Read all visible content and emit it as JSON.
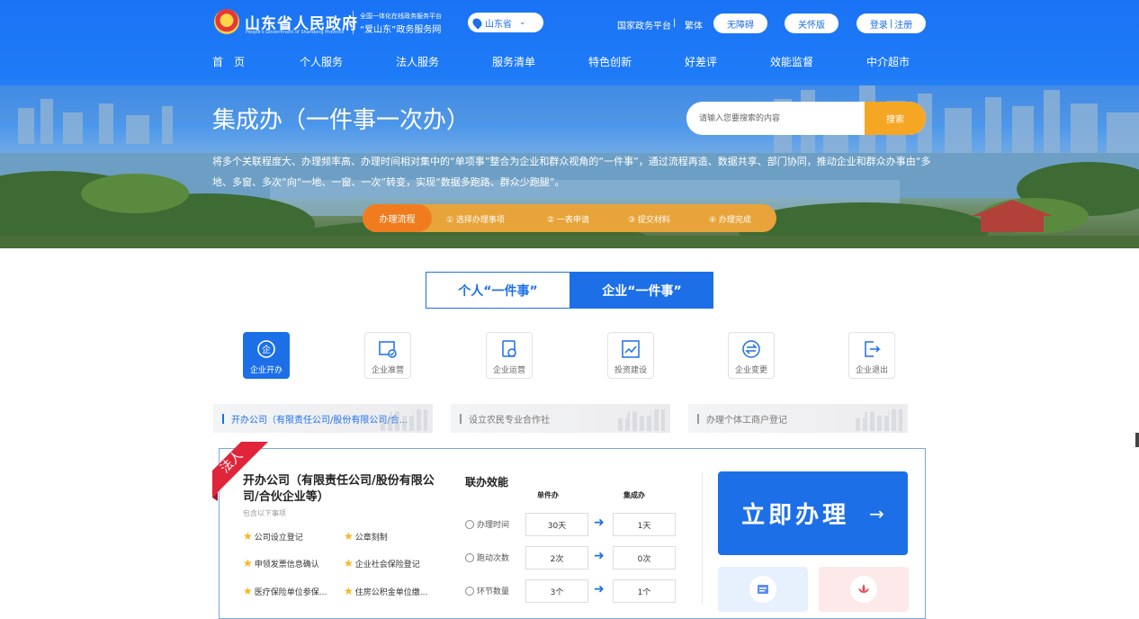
{
  "header": {
    "gov_title": "山东省人民政府",
    "gov_subtitle": "People's Government of Shandong Province",
    "platform_line1": "全国一体化在线政务服务平台",
    "platform_line2": "“爱山东”政务服务网",
    "region": "山东省",
    "national_platform": "国家政务平台",
    "divider": "|",
    "traditional": "繁体",
    "accessibility": "无障碍",
    "care_mode": "关怀版",
    "login": "登录",
    "login_divider": "|",
    "register": "注册"
  },
  "nav": [
    "首　页",
    "个人服务",
    "法人服务",
    "服务清单",
    "特色创新",
    "好差评",
    "效能监督",
    "中介超市"
  ],
  "hero": {
    "title": "集成办（一件事一次办）",
    "search_placeholder": "请输入您要搜索的内容",
    "search_button": "搜索",
    "description": "将多个关联程度大、办理频率高、办理时间相对集中的“单项事”整合为企业和群众视角的“一件事”，通过流程再造、数据共享、部门协同，推动企业和群众办事由“多地、多窗、多次”向“一地、一窗、一次”转变，实现“数据多跑路、群众少跑腿”。",
    "process_label": "办理流程",
    "process_steps": [
      "① 选择办理事项",
      "② 一表申请",
      "③ 提交材料",
      "④ 办理完成"
    ]
  },
  "tabs": {
    "personal": "个人“一件事”",
    "enterprise": "企业“一件事”"
  },
  "categories": [
    "企业开办",
    "企业准营",
    "企业运营",
    "投资建设",
    "企业变更",
    "企业退出"
  ],
  "subtabs": [
    "开办公司（有限责任公司/股份有限公司/合...",
    "设立农民专业合作社",
    "办理个体工商户登记"
  ],
  "card": {
    "ribbon": "法人",
    "title": "开办公司（有限责任公司/股份有限公司/合伙企业等）",
    "subtitle": "包含以下事项",
    "items": [
      "公司设立登记",
      "公章刻制",
      "申领发票信息确认",
      "企业社会保险登记",
      "医疗保险单位参保...",
      "住房公积金单位缴..."
    ],
    "efficiency_title": "联办效能",
    "col_single": "单件办",
    "col_integrated": "集成办",
    "rows": [
      {
        "label": "办理时间",
        "single": "30天",
        "integrated": "1天"
      },
      {
        "label": "跑动次数",
        "single": "2次",
        "integrated": "0次"
      },
      {
        "label": "环节数量",
        "single": "3个",
        "integrated": "1个"
      }
    ],
    "action_button": "立即办理",
    "action_arrow": "→"
  },
  "icons": {
    "location": "location-pin-icon",
    "chevron": "chevron-down-icon",
    "arrow": "arrow-right-icon",
    "star": "star-icon"
  },
  "colors": {
    "brand_blue": "#1d6fe8",
    "orange": "#f5a623",
    "ribbon_red": "#e0243a",
    "star": "#f5b820"
  }
}
